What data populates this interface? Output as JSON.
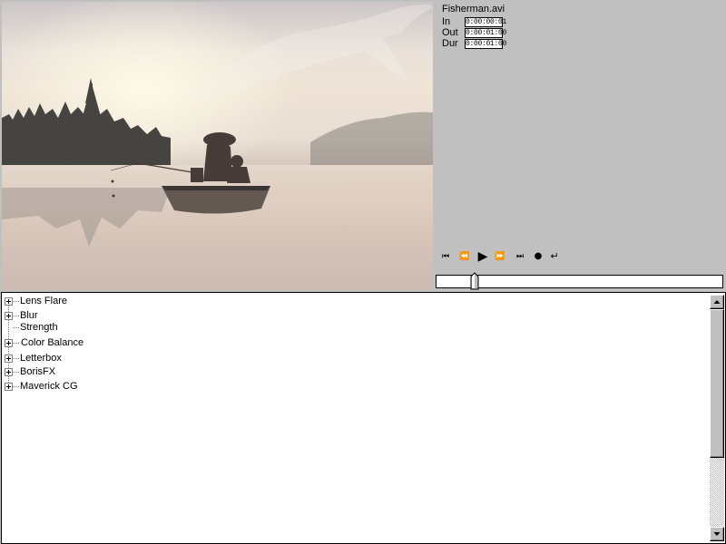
{
  "preview": {
    "clip_name": "Fisherman.avi"
  },
  "timecodes": [
    {
      "label": "In",
      "value": "0:00:00:01"
    },
    {
      "label": "Out",
      "value": "0:00:01:00"
    },
    {
      "label": "Dur",
      "value": "0:00:01:00"
    }
  ],
  "transport": {
    "rewind_icon": "skip-to-start-icon",
    "step_back_icon": "step-back-icon",
    "play_icon": "play-icon",
    "step_forward_icon": "step-forward-icon",
    "end_icon": "skip-to-end-icon",
    "record_icon": "record-icon",
    "loop_icon": "loop-icon"
  },
  "scrubber": {
    "position_fraction": 0.12
  },
  "effects_tree": {
    "items": [
      {
        "label": "Lens Flare",
        "expandable": true
      },
      {
        "label": "Blur",
        "expandable": true
      },
      {
        "label": "Strength",
        "expandable": false
      },
      {
        "label": "Color Balance",
        "expandable": true
      },
      {
        "label": "Letterbox",
        "expandable": true
      },
      {
        "label": "BorisFX",
        "expandable": true
      },
      {
        "label": "Maverick CG",
        "expandable": true
      }
    ]
  },
  "colors": {
    "panel_bg": "#c0c0c0",
    "tree_bg": "#ffffff"
  }
}
